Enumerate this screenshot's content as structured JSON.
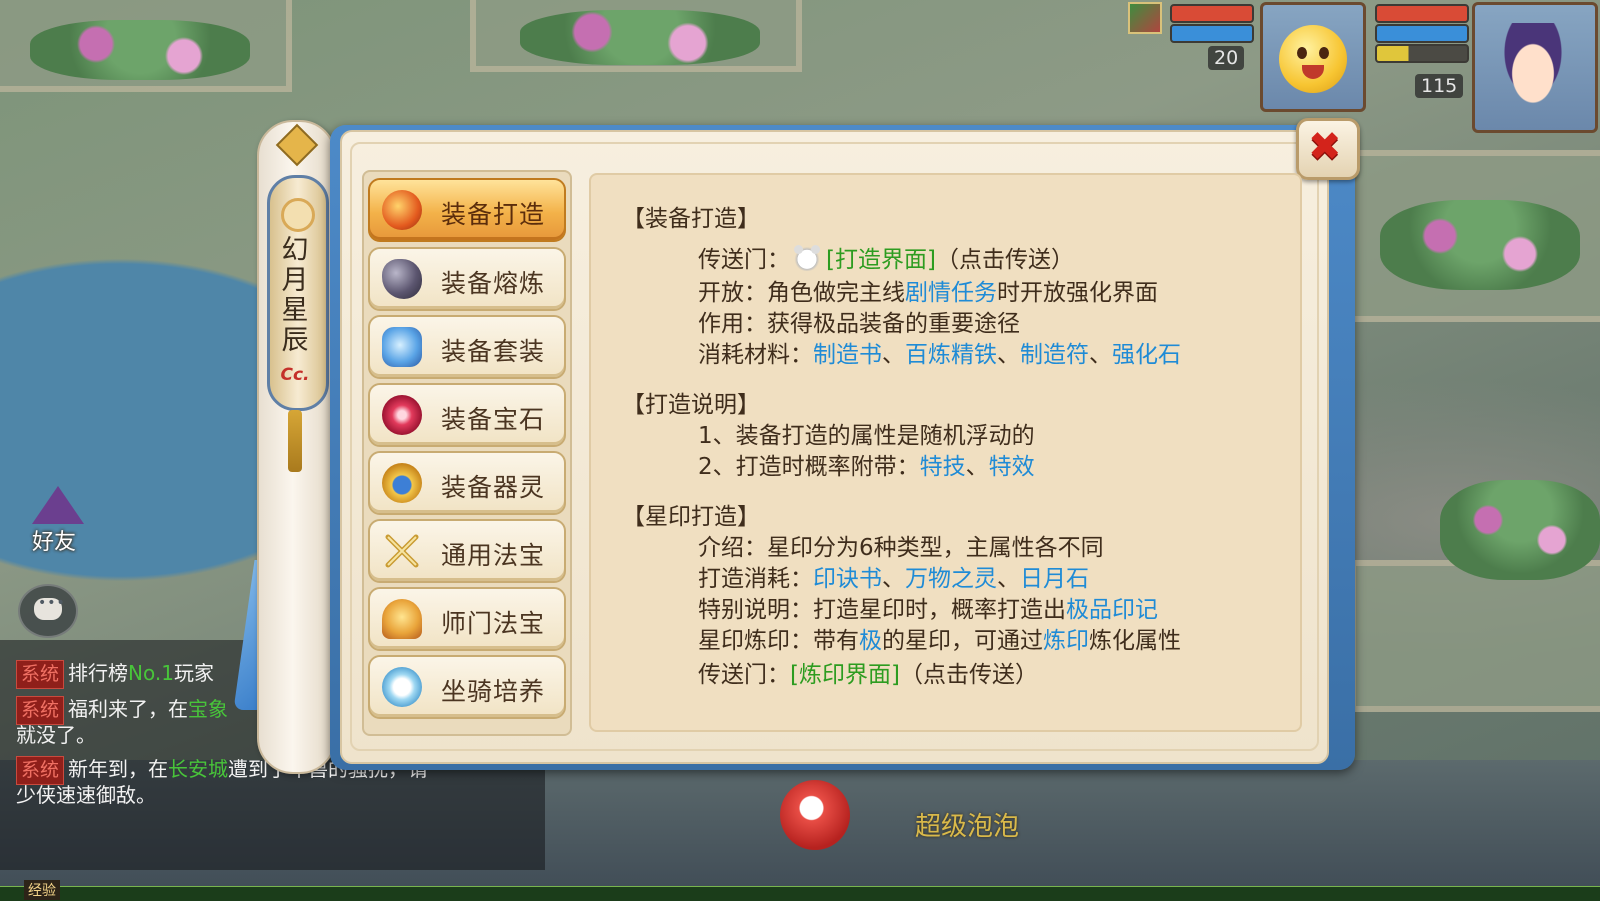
{
  "hud": {
    "pet_level": "20",
    "hero_level": "115",
    "colors": {
      "hp": "#d94b36",
      "mp": "#3a8fd9",
      "exp": "#e0c63b"
    }
  },
  "sidebar": {
    "friend_label": "好友",
    "banner_title": "幻月星辰",
    "banner_badge": "Cc."
  },
  "chat": {
    "lines": [
      {
        "tag": "系统",
        "text": "排行榜",
        "green": "No.1",
        "tail": "玩家"
      },
      {
        "tag": "系统",
        "text": "福利来了，在",
        "green": "宝象",
        "tail": ""
      },
      {
        "tag": "",
        "text": "就没了。",
        "green": "",
        "tail": ""
      },
      {
        "tag": "系统",
        "text": "新年到，在",
        "green": "长安城",
        "tail": "遭到了年兽的骚扰，请"
      },
      {
        "tag": "",
        "text": "少侠速速御敌。",
        "green": "",
        "tail": ""
      }
    ],
    "exp_label": "经验"
  },
  "scene": {
    "bottom_label": "超级泡泡"
  },
  "menu": {
    "items": [
      {
        "label": "装备打造",
        "icon": "forge-icon",
        "active": true
      },
      {
        "label": "装备熔炼",
        "icon": "ore-icon",
        "active": false
      },
      {
        "label": "装备套装",
        "icon": "armor-set-icon",
        "active": false
      },
      {
        "label": "装备宝石",
        "icon": "gem-icon",
        "active": false
      },
      {
        "label": "装备器灵",
        "icon": "spirit-icon",
        "active": false
      },
      {
        "label": "通用法宝",
        "icon": "crossed-swords-icon",
        "active": false
      },
      {
        "label": "师门法宝",
        "icon": "bell-icon",
        "active": false
      },
      {
        "label": "坐骑培养",
        "icon": "mount-icon",
        "active": false
      }
    ]
  },
  "content": {
    "s1_title": "【装备打造】",
    "s1_portal_label": "传送门：",
    "s1_portal_link": "[打造界面]",
    "s1_portal_tail": "（点击传送）",
    "s1_open_label": "开放：角色做完主线",
    "s1_open_link": "剧情任务",
    "s1_open_tail": "时开放强化界面",
    "s1_use": "作用：获得极品装备的重要途径",
    "s1_cost_label": "消耗材料：",
    "s1_cost_items": [
      "制造书",
      "百炼精铁",
      "制造符",
      "强化石"
    ],
    "s1_sep": "、",
    "s2_title": "【打造说明】",
    "s2_line1": "1、装备打造的属性是随机浮动的",
    "s2_line2_label": "2、打造时概率附带：",
    "s2_line2_items": [
      "特技",
      "特效"
    ],
    "s3_title": "【星印打造】",
    "s3_intro": "介绍：星印分为6种类型，主属性各不同",
    "s3_cost_label": "打造消耗：",
    "s3_cost_items": [
      "印诀书",
      "万物之灵",
      "日月石"
    ],
    "s3_special_label": "特别说明：打造星印时，概率打造出",
    "s3_special_link": "极品印记",
    "s3_refine_a": "星印炼印：带有",
    "s3_refine_b": "极",
    "s3_refine_c": "的星印，可通过",
    "s3_refine_d": "炼印",
    "s3_refine_e": "炼化属性",
    "s3_portal_label": "传送门：",
    "s3_portal_link": "[炼印界面]",
    "s3_portal_tail": "（点击传送）"
  }
}
